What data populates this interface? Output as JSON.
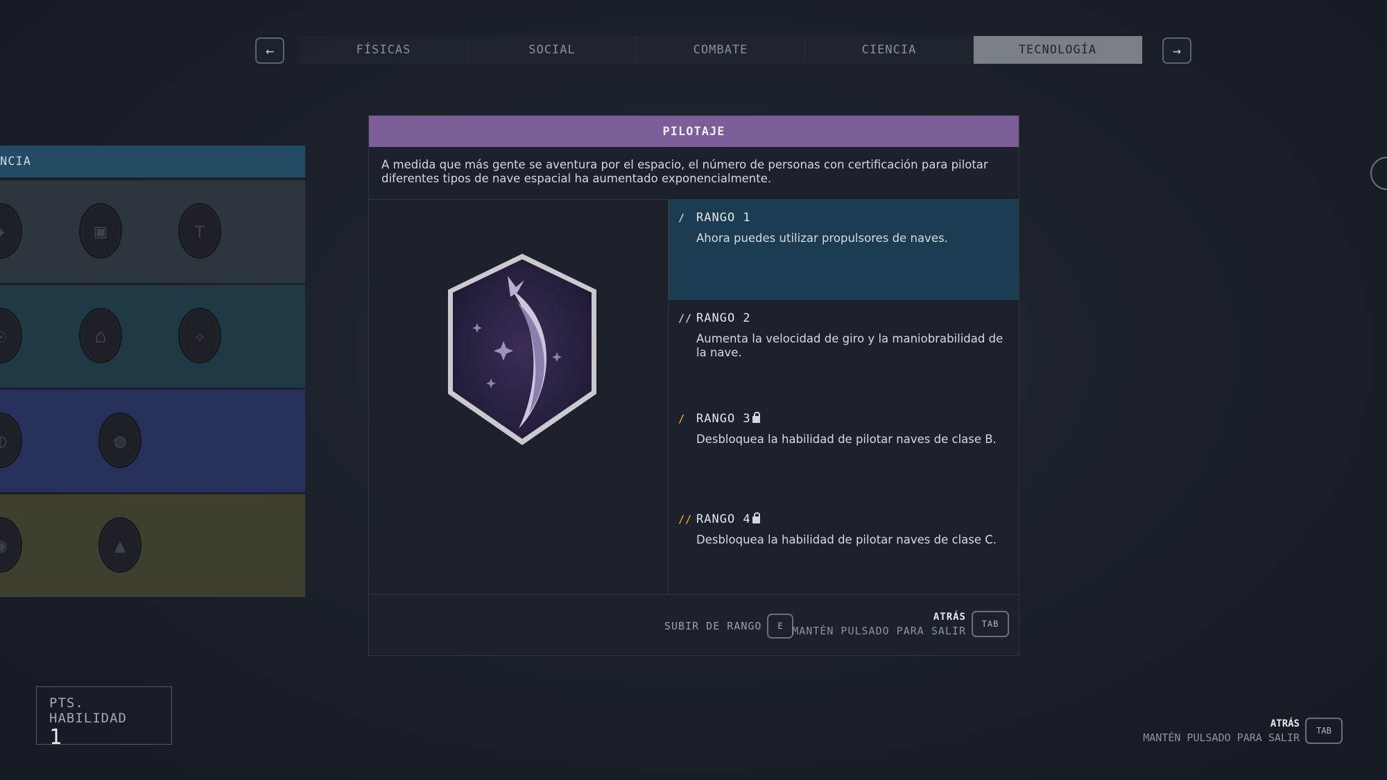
{
  "tabs": {
    "prev_icon": "arrow-left-icon",
    "next_icon": "arrow-right-icon",
    "items": [
      {
        "label": "FÍSICAS"
      },
      {
        "label": "SOCIAL"
      },
      {
        "label": "COMBATE"
      },
      {
        "label": "CIENCIA"
      },
      {
        "label": "TECNOLOGÍA",
        "active": true
      }
    ]
  },
  "tree": {
    "header": "NCIA",
    "row_colors": [
      "#2d353d",
      "#1f3a44",
      "#27305a",
      "#3f3f30"
    ]
  },
  "dialog": {
    "title": "PILOTAJE",
    "description": "A medida que más gente se aventura por el espacio, el número de personas con certificación para pilotar diferentes tipos de nave espacial ha aumentado exponencialmente.",
    "title_color": "#7b5d97",
    "ranks": [
      {
        "bars": "/",
        "label": "RANGO 1",
        "locked": false,
        "active": true,
        "desc": "Ahora puedes utilizar propulsores de naves."
      },
      {
        "bars": "//",
        "label": "RANGO 2",
        "locked": false,
        "active": false,
        "desc": "Aumenta la velocidad de giro y la maniobrabilidad de la nave."
      },
      {
        "bars": "/",
        "label": "RANGO 3",
        "locked": true,
        "active": false,
        "desc": "Desbloquea la habilidad de pilotar naves de clase B."
      },
      {
        "bars": "//",
        "label": "RANGO 4",
        "locked": true,
        "active": false,
        "desc": "Desbloquea la habilidad de pilotar naves de clase C."
      }
    ],
    "footer": {
      "rank_up_label": "SUBIR DE RANGO",
      "rank_up_key": "E",
      "back_label": "ATRÁS",
      "back_sub": "MANTÉN PULSADO PARA SALIR",
      "back_key": "TAB"
    }
  },
  "points": {
    "label": "PTS. HABILIDAD",
    "value": "1"
  },
  "global_back": {
    "label": "ATRÁS",
    "sub": "MANTÉN PULSADO PARA SALIR",
    "key": "TAB"
  }
}
